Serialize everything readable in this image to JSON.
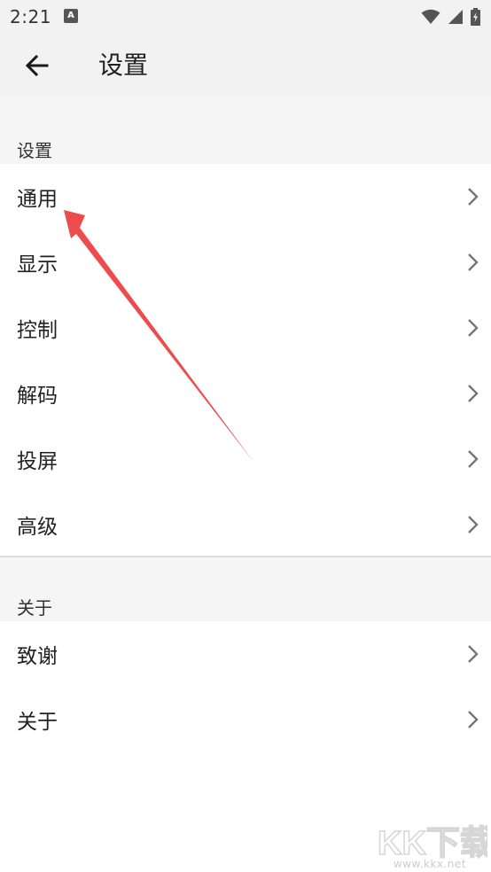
{
  "status_bar": {
    "time": "2:21",
    "notification_icon_letter": "A"
  },
  "toolbar": {
    "title": "设置",
    "back_icon": "arrow-left-icon"
  },
  "sections": [
    {
      "header": "设置",
      "items": [
        {
          "label": "通用"
        },
        {
          "label": "显示"
        },
        {
          "label": "控制"
        },
        {
          "label": "解码"
        },
        {
          "label": "投屏"
        },
        {
          "label": "高级"
        }
      ]
    },
    {
      "header": "关于",
      "items": [
        {
          "label": "致谢"
        },
        {
          "label": "关于"
        }
      ]
    }
  ],
  "annotation": {
    "color": "#ee4c4c"
  },
  "watermark": {
    "text": "KK下载",
    "url": "www.kkx.net"
  }
}
